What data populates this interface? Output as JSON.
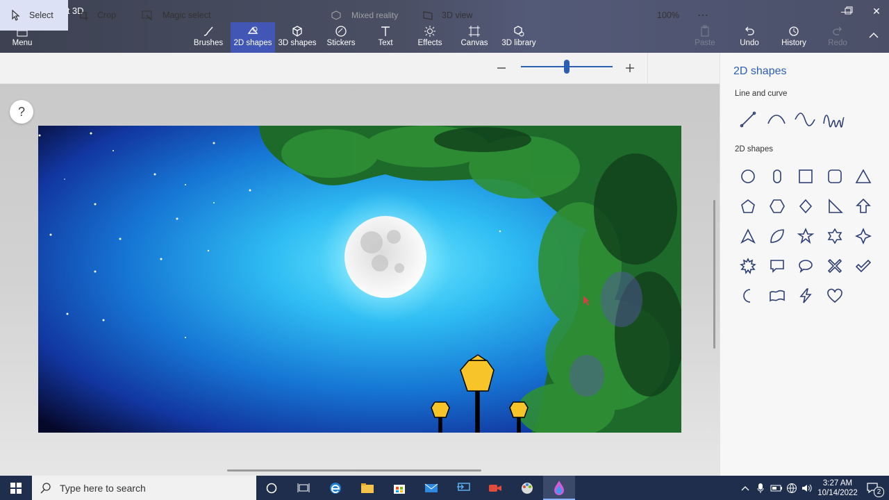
{
  "window": {
    "title": "Untitled* - Paint 3D"
  },
  "menu": {
    "label": "Menu"
  },
  "tools": [
    {
      "label": "Brushes"
    },
    {
      "label": "2D shapes"
    },
    {
      "label": "3D shapes"
    },
    {
      "label": "Stickers"
    },
    {
      "label": "Text"
    },
    {
      "label": "Effects"
    },
    {
      "label": "Canvas"
    },
    {
      "label": "3D library"
    }
  ],
  "actions": {
    "paste": "Paste",
    "undo": "Undo",
    "history": "History",
    "redo": "Redo"
  },
  "subtoolbar": {
    "select": "Select",
    "crop": "Crop",
    "magic_select": "Magic select",
    "mixed_reality": "Mixed reality",
    "view_3d": "3D view",
    "zoom": "100%",
    "zoom_fraction": 0.5
  },
  "help": "?",
  "panel": {
    "title": "2D shapes",
    "section_lines": "Line and curve",
    "section_shapes": "2D shapes",
    "line_tools": [
      "line-icon",
      "curve-icon",
      "wave-icon",
      "zigzag-curve-icon"
    ],
    "shapes": [
      "circle-icon",
      "rounded-capsule-icon",
      "square-icon",
      "rounded-square-icon",
      "triangle-icon",
      "pentagon-icon",
      "hexagon-icon",
      "diamond-icon",
      "right-triangle-icon",
      "arrow-up-icon",
      "pointed-triangle-icon",
      "leaf-icon",
      "five-point-star-icon",
      "six-point-star-icon",
      "four-point-star-icon",
      "burst-icon",
      "speech-rect-icon",
      "speech-oval-icon",
      "x-mark-icon",
      "check-mark-icon",
      "crescent-icon",
      "banner-icon",
      "lightning-icon",
      "heart-icon"
    ]
  },
  "taskbar": {
    "search_placeholder": "Type here to search",
    "time": "3:27 AM",
    "date": "10/14/2022",
    "notification_count": "2"
  },
  "colors": {
    "accent": "#4257b5",
    "panel_title": "#2b5fb3",
    "shape_stroke": "#2d3e74"
  }
}
